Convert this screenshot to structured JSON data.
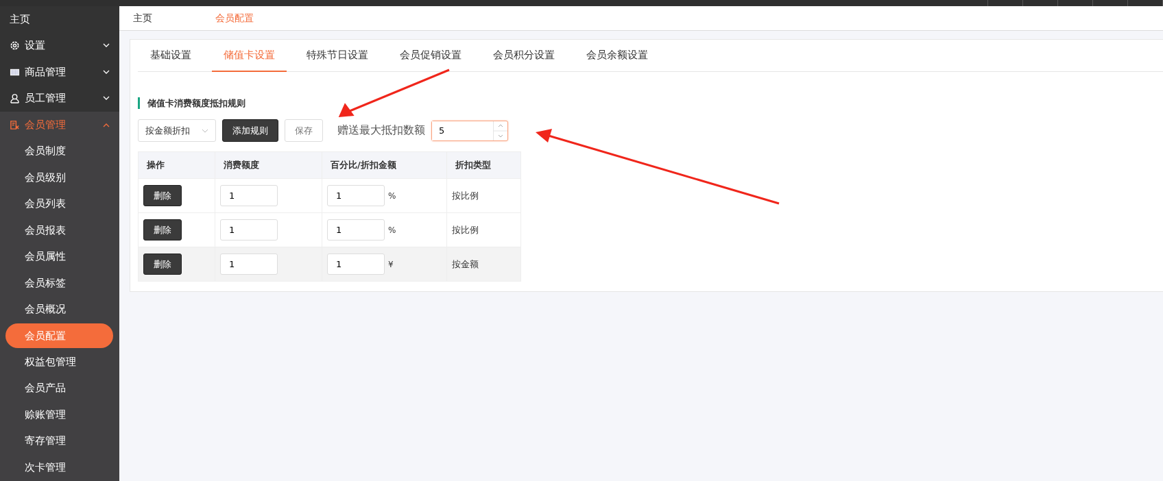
{
  "sidebar": {
    "home": "主页",
    "groups": [
      {
        "label": "设置",
        "expanded": false,
        "selected": false
      },
      {
        "label": "商品管理",
        "expanded": false,
        "selected": false
      },
      {
        "label": "员工管理",
        "expanded": false,
        "selected": false
      },
      {
        "label": "会员管理",
        "expanded": true,
        "selected": true,
        "children": [
          {
            "label": "会员制度",
            "selected": false
          },
          {
            "label": "会员级别",
            "selected": false
          },
          {
            "label": "会员列表",
            "selected": false
          },
          {
            "label": "会员报表",
            "selected": false
          },
          {
            "label": "会员属性",
            "selected": false
          },
          {
            "label": "会员标签",
            "selected": false
          },
          {
            "label": "会员概况",
            "selected": false
          },
          {
            "label": "会员配置",
            "selected": true
          },
          {
            "label": "权益包管理",
            "selected": false
          },
          {
            "label": "会员产品",
            "selected": false
          },
          {
            "label": "赊账管理",
            "selected": false
          },
          {
            "label": "寄存管理",
            "selected": false
          },
          {
            "label": "次卡管理",
            "selected": false
          }
        ]
      }
    ]
  },
  "breadcrumb": [
    {
      "label": "主页",
      "selected": false
    },
    {
      "label": "会员配置",
      "selected": true
    }
  ],
  "tabs": [
    {
      "label": "基础设置",
      "selected": false
    },
    {
      "label": "储值卡设置",
      "selected": true
    },
    {
      "label": "特殊节日设置",
      "selected": false
    },
    {
      "label": "会员促销设置",
      "selected": false
    },
    {
      "label": "会员积分设置",
      "selected": false
    },
    {
      "label": "会员余额设置",
      "selected": false
    }
  ],
  "section_title": "储值卡消费额度抵扣规则",
  "toolbar": {
    "discount_mode": "按金额折扣",
    "add_button": "添加规则",
    "save_button": "保存",
    "save_disabled": true,
    "max_label": "赠送最大抵扣数额",
    "max_value": "5"
  },
  "table": {
    "columns": [
      "操作",
      "消费额度",
      "百分比/折扣金额",
      "折扣类型"
    ],
    "rows": [
      {
        "action": "删除",
        "amount": "1",
        "discount": "1",
        "unit": "%",
        "type": "按比例",
        "hovered": false
      },
      {
        "action": "删除",
        "amount": "1",
        "discount": "1",
        "unit": "%",
        "type": "按比例",
        "hovered": false
      },
      {
        "action": "删除",
        "amount": "1",
        "discount": "1",
        "unit": "¥",
        "type": "按金额",
        "hovered": true
      }
    ]
  }
}
